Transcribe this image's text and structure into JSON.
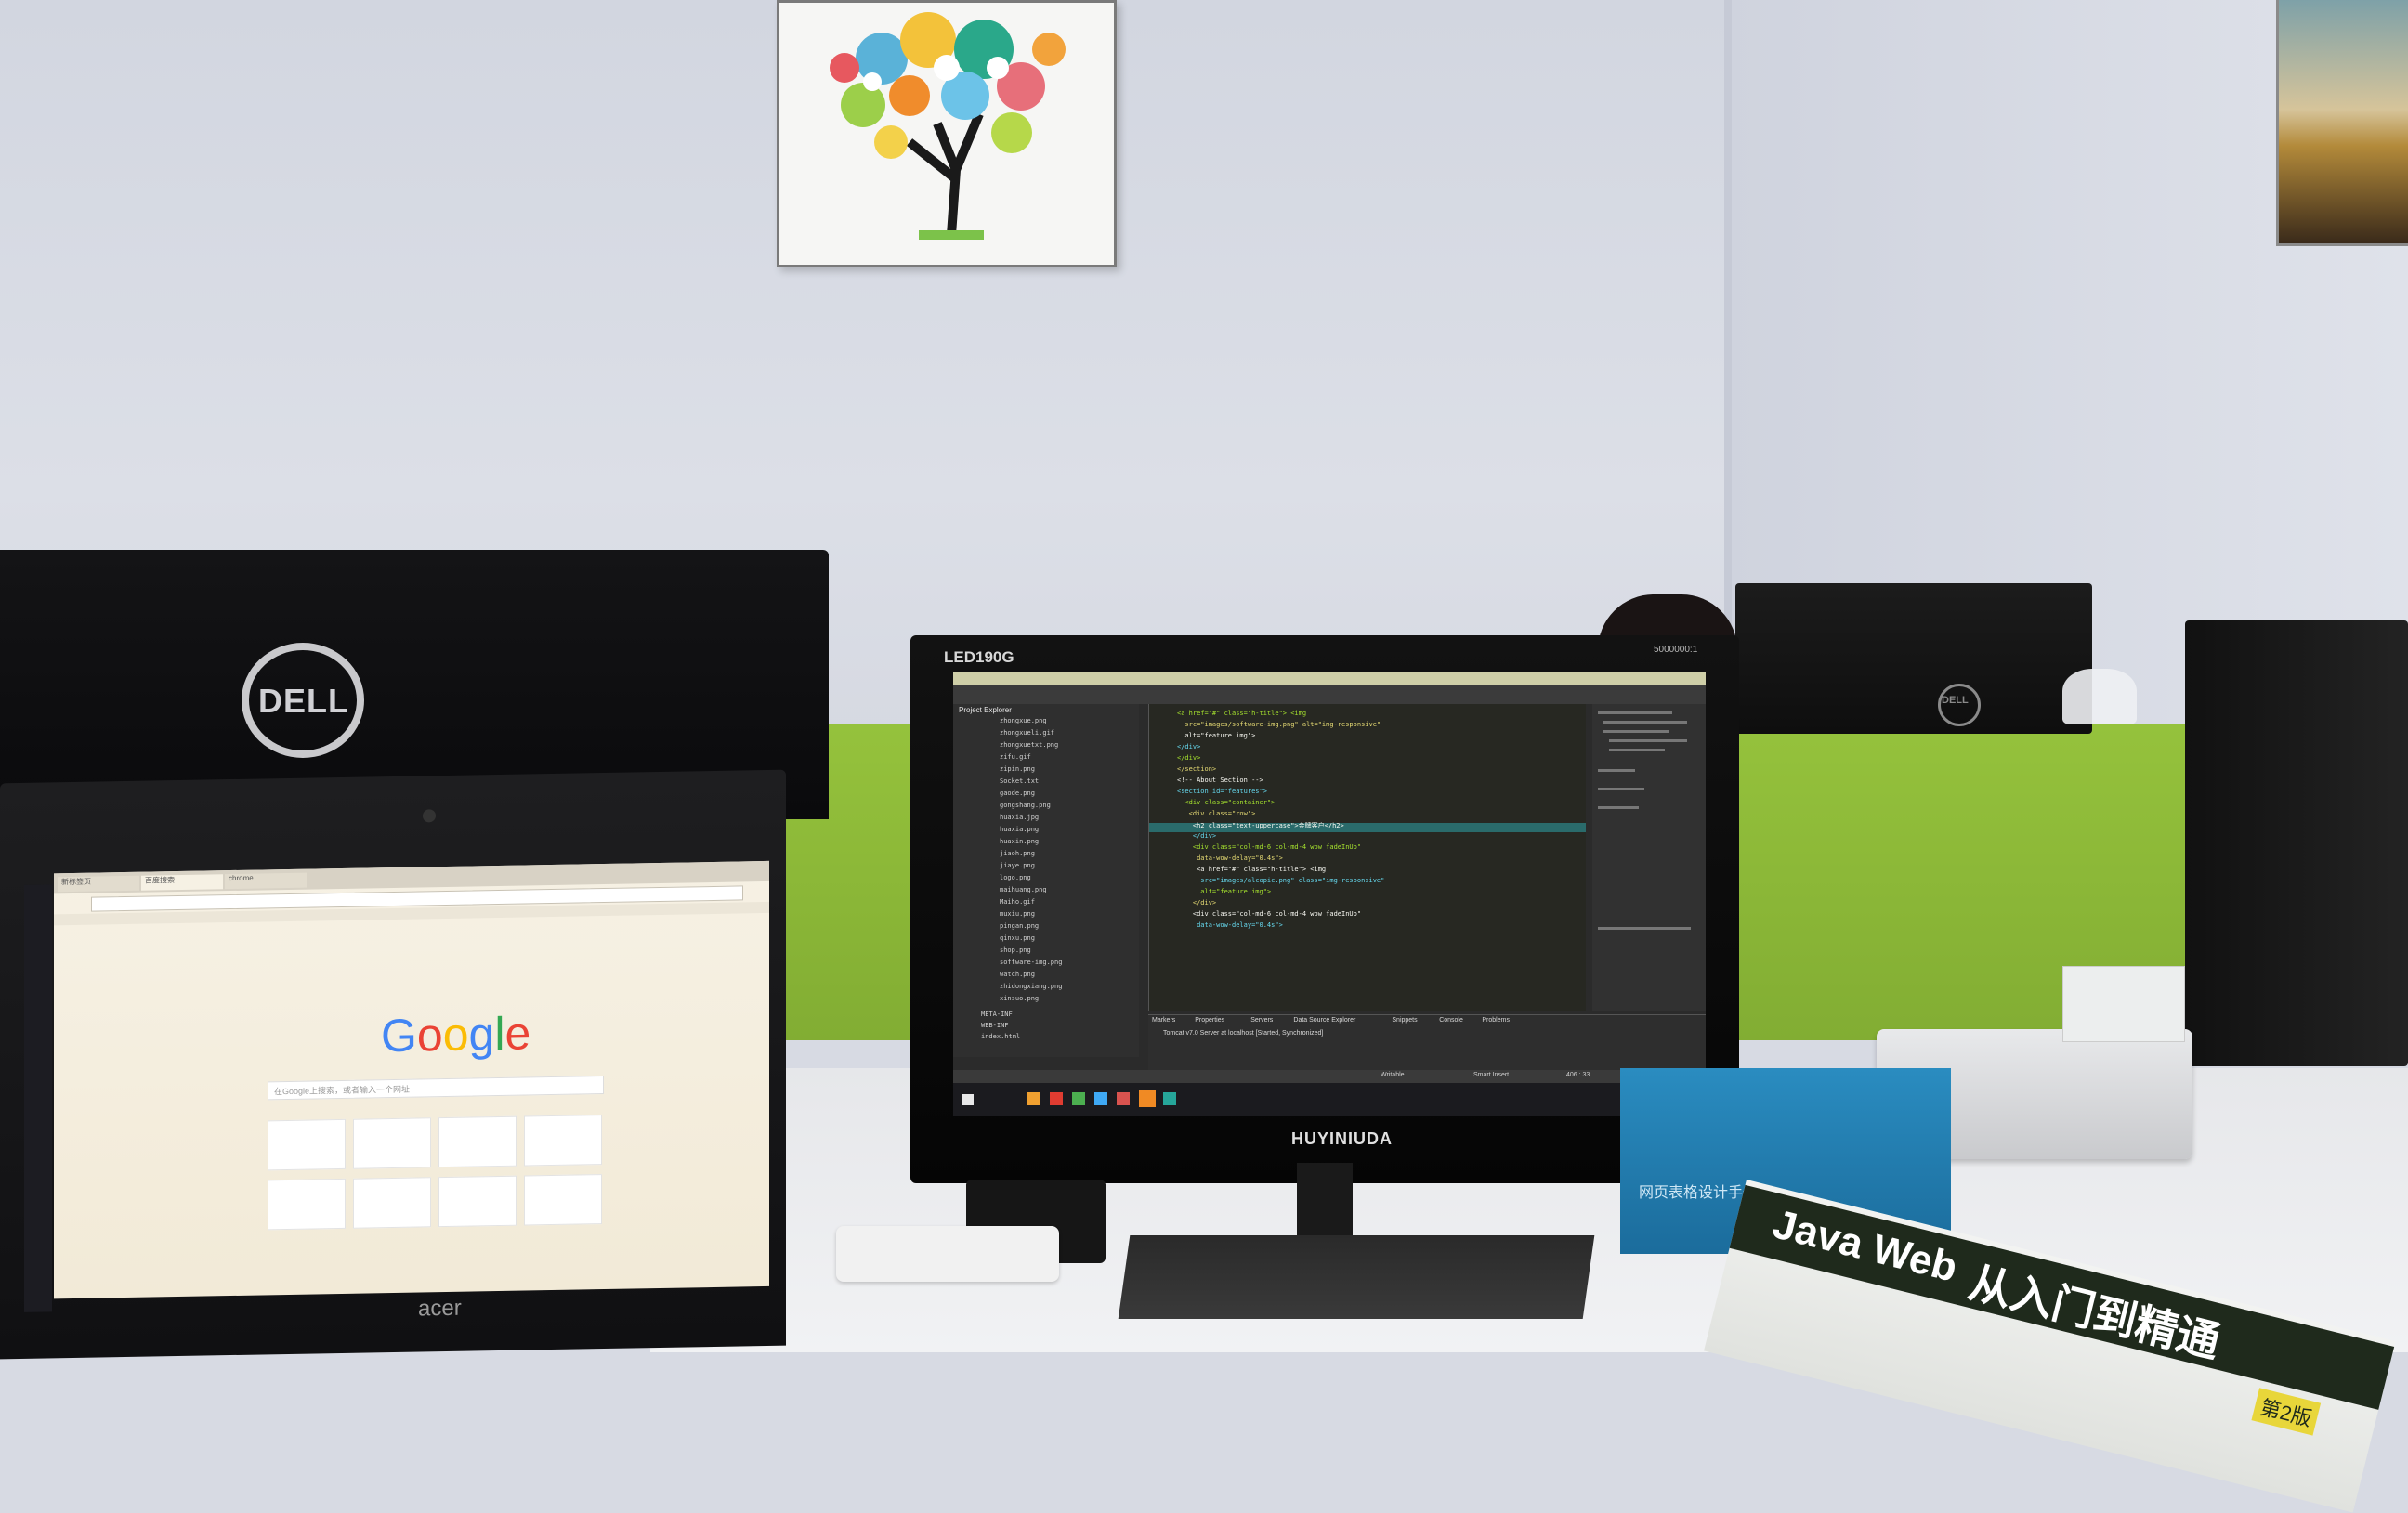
{
  "scene": {
    "wall_color": "#d5d8e2",
    "partition_color": "#8cb83a",
    "desk_color": "#e9eaec"
  },
  "left_monitor": {
    "brand": "DELL"
  },
  "right_monitor_back": {
    "brand": "DELL"
  },
  "center_monitor": {
    "model": "LED190G",
    "brand": "HUYINIUDA",
    "ratio_badge": "5000000:1",
    "ide": {
      "panel_title": "Project Explorer",
      "files": [
        "zhongxue.png",
        "zhongxueli.gif",
        "zhongxuetxt.png",
        "zifu.gif",
        "zipin.png",
        "Socket.txt",
        "gaode.png",
        "gongshang.png",
        "huaxia.jpg",
        "huaxia.png",
        "huaxin.png",
        "jiaoh.png",
        "jiaye.png",
        "logo.png",
        "maihuang.png",
        "Maiho.gif",
        "muxiu.png",
        "pingan.png",
        "qinxu.png",
        "shop.png",
        "software-img.png",
        "watch.png",
        "zhidongxiang.png",
        "xinsuo.png"
      ],
      "folders": [
        "META-INF",
        "WEB-INF",
        "index.html"
      ],
      "code_lines": [
        "<a href=\"#\" class=\"h-title\"> <img",
        "  src=\"images/software-img.png\" alt=\"img-responsive\"",
        "  alt=\"feature img\">",
        "</div>",
        "</div>",
        "</section>",
        "<!-- About Section -->",
        "<section id=\"features\">",
        "  <div class=\"container\">",
        "   <div class=\"row\">",
        "    <h2 class=\"text-uppercase\">金牌客户</h2>",
        "    </div>",
        "    <div class=\"col-md-6 col-md-4 wow fadeInUp\"",
        "     data-wow-delay=\"0.4s\">",
        "     <a href=\"#\" class=\"h-title\"> <img",
        "      src=\"images/alcopic.png\" class=\"img-responsive\"",
        "      alt=\"feature img\">",
        "    </div>",
        "    <div class=\"col-md-6 col-md-4 wow fadeInUp\"",
        "     data-wow-delay=\"0.4s\">"
      ],
      "console_tabs": [
        "Markers",
        "Properties",
        "Servers",
        "Data Source Explorer",
        "Snippets",
        "Console",
        "Problems"
      ],
      "console_line": "Tomcat v7.0 Server at localhost  [Started, Synchronized]",
      "status_items": [
        "Writable",
        "Smart Insert",
        "406 : 33"
      ]
    }
  },
  "laptop": {
    "brand": "acer",
    "browser": {
      "tabs": [
        "新标签页",
        "百度搜索",
        "chrome"
      ],
      "logo_letters": [
        "G",
        "o",
        "o",
        "g",
        "l",
        "e"
      ],
      "logo_colors": [
        "#4285f4",
        "#ea4335",
        "#fbbc05",
        "#4285f4",
        "#34a853",
        "#ea4335"
      ],
      "search_placeholder": "在Google上搜索，或者输入一个网址"
    }
  },
  "book": {
    "title_en": "Java Web",
    "title_cn": "从入门到精通",
    "badge": "第2版"
  },
  "blue_box": {
    "text": "网页表格设计手册"
  }
}
